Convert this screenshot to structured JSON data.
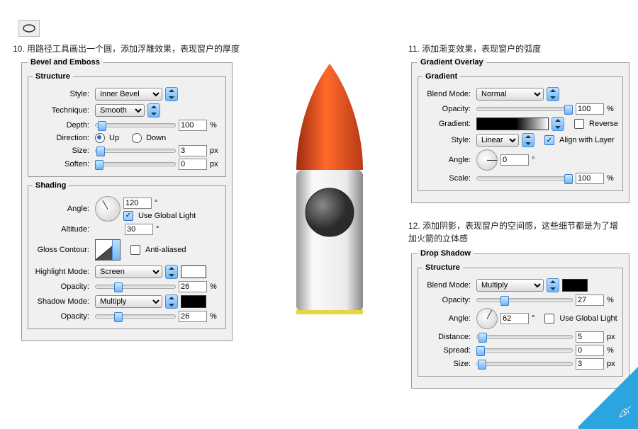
{
  "tool_icon": "ellipse-shape-tool",
  "captions": {
    "c10_num": "10.",
    "c10": "用路径工具画出一个圆，添加浮雕效果，表现窗户的厚度",
    "c11_num": "11.",
    "c11": "添加渐变效果，表现窗户的弧度",
    "c12_num": "12.",
    "c12": "添加阴影，表现窗户的空间感，这些细节都是为了增加火箭的立体感"
  },
  "bevel": {
    "title": "Bevel and Emboss",
    "structure_title": "Structure",
    "style_lbl": "Style:",
    "style": "Inner Bevel",
    "technique_lbl": "Technique:",
    "technique": "Smooth",
    "depth_lbl": "Depth:",
    "depth": "100",
    "depth_unit": "%",
    "direction_lbl": "Direction:",
    "dir_up": "Up",
    "dir_down": "Down",
    "size_lbl": "Size:",
    "size": "3",
    "soften_lbl": "Soften:",
    "soften": "0",
    "px": "px",
    "shading_title": "Shading",
    "angle_lbl": "Angle:",
    "angle": "120",
    "use_global": "Use Global Light",
    "altitude_lbl": "Altitude:",
    "altitude": "30",
    "gloss_lbl": "Gloss Contour:",
    "antialias": "Anti-aliased",
    "highlight_lbl": "Highlight Mode:",
    "highlight": "Screen",
    "opacity_lbl": "Opacity:",
    "h_opacity": "26",
    "shadow_lbl": "Shadow Mode:",
    "shadow": "Multiply",
    "s_opacity": "26"
  },
  "gradient": {
    "title": "Gradient Overlay",
    "sub": "Gradient",
    "blend_lbl": "Blend Mode:",
    "blend": "Normal",
    "opacity_lbl": "Opacity:",
    "opacity": "100",
    "pct": "%",
    "gradient_lbl": "Gradient:",
    "reverse": "Reverse",
    "style_lbl": "Style:",
    "style": "Linear",
    "align": "Align with Layer",
    "angle_lbl": "Angle:",
    "angle": "0",
    "scale_lbl": "Scale:",
    "scale": "100"
  },
  "dropshadow": {
    "title": "Drop Shadow",
    "sub": "Structure",
    "blend_lbl": "Blend Mode:",
    "blend": "Multiply",
    "opacity_lbl": "Opacity:",
    "opacity": "27",
    "pct": "%",
    "angle_lbl": "Angle:",
    "angle": "62",
    "use_global": "Use Global Light",
    "distance_lbl": "Distance:",
    "distance": "5",
    "spread_lbl": "Spread:",
    "spread": "0",
    "size_lbl": "Size:",
    "size": "3",
    "px": "px"
  },
  "corner": "<3)~"
}
